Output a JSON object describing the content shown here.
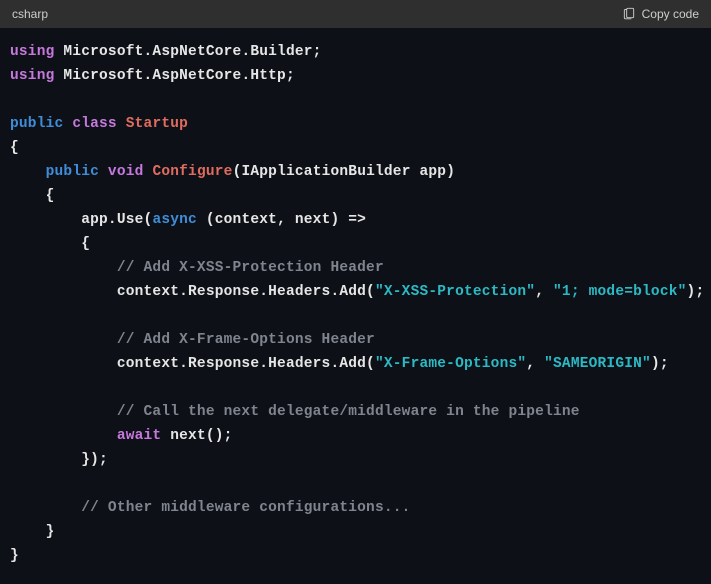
{
  "header": {
    "language_label": "csharp",
    "copy_label": "Copy code"
  },
  "code": {
    "using1_kw": "using",
    "using1_ns": " Microsoft.AspNetCore.Builder;",
    "using2_kw": "using",
    "using2_ns": " Microsoft.AspNetCore.Http;",
    "public1": "public",
    "class_kw": " class ",
    "class_name": "Startup",
    "open_brace1": "{",
    "public2": "public",
    "void_kw": " void ",
    "configure": "Configure",
    "configure_params": "(IApplicationBuilder app)",
    "open_brace2": "    {",
    "appuse_pre": "        app.Use(",
    "async_kw": "async",
    "appuse_post": " (context, next) =>",
    "open_brace3": "        {",
    "comment1": "            // Add X-XSS-Protection Header",
    "add1_pre": "            context.Response.Headers.Add(",
    "add1_str1": "\"X-XSS-Protection\"",
    "add1_sep": ", ",
    "add1_str2": "\"1; mode=block\"",
    "add1_post": ");",
    "comment2": "            // Add X-Frame-Options Header",
    "add2_pre": "            context.Response.Headers.Add(",
    "add2_str1": "\"X-Frame-Options\"",
    "add2_sep": ", ",
    "add2_str2": "\"SAMEORIGIN\"",
    "add2_post": ");",
    "comment3": "            // Call the next delegate/middleware in the pipeline",
    "await_kw": "await",
    "next_call": " next();",
    "close_lambda": "        });",
    "comment4": "        // Other middleware configurations...",
    "close_brace2": "    }",
    "close_brace1": "}"
  }
}
